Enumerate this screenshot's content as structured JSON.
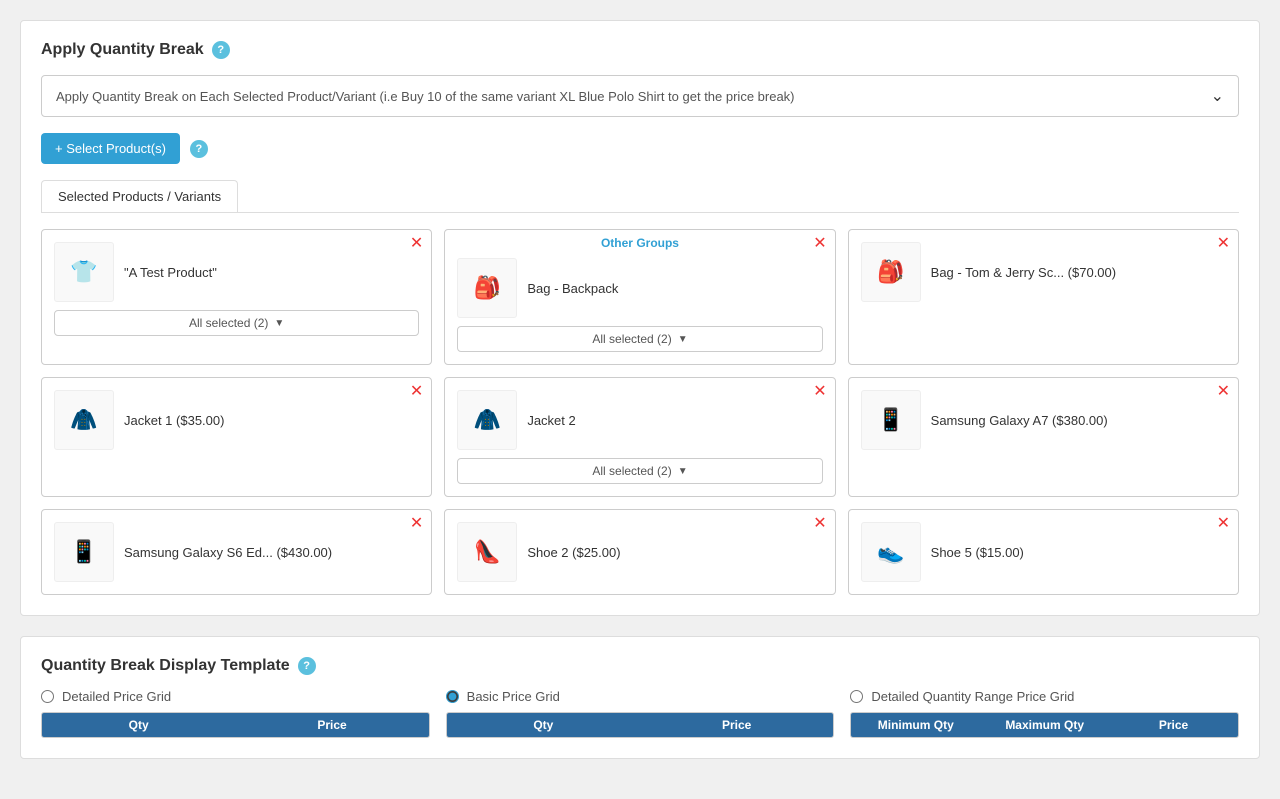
{
  "apply_qty_break": {
    "title": "Apply Quantity Break",
    "dropdown_value": "Apply Quantity Break on Each Selected Product/Variant (i.e Buy 10 of the same variant XL Blue Polo Shirt to get the price break)",
    "select_btn_label": "+ Select Product(s)",
    "tab_label": "Selected Products / Variants"
  },
  "products": [
    {
      "id": "a-test-product",
      "name": "\"A Test Product\"",
      "emoji": "👕",
      "has_variant_dropdown": true,
      "variant_label": "All selected (2)",
      "other_groups": false
    },
    {
      "id": "bag-backpack",
      "name": "Bag - Backpack",
      "emoji": "🎒",
      "has_variant_dropdown": true,
      "variant_label": "All selected (2)",
      "other_groups": true,
      "other_groups_label": "Other Groups"
    },
    {
      "id": "bag-tom-jerry",
      "name": "Bag - Tom & Jerry Sc... ($70.00)",
      "emoji": "🎒",
      "has_variant_dropdown": false,
      "other_groups": false
    },
    {
      "id": "jacket-1",
      "name": "Jacket 1 ($35.00)",
      "emoji": "🧥",
      "has_variant_dropdown": false,
      "other_groups": false
    },
    {
      "id": "jacket-2",
      "name": "Jacket 2",
      "emoji": "🧥",
      "has_variant_dropdown": true,
      "variant_label": "All selected (2)",
      "other_groups": false
    },
    {
      "id": "samsung-galaxy-a7",
      "name": "Samsung Galaxy A7 ($380.00)",
      "emoji": "📱",
      "has_variant_dropdown": false,
      "other_groups": false
    },
    {
      "id": "samsung-galaxy-s6",
      "name": "Samsung Galaxy S6 Ed... ($430.00)",
      "emoji": "📱",
      "has_variant_dropdown": false,
      "other_groups": false
    },
    {
      "id": "shoe-2",
      "name": "Shoe 2 ($25.00)",
      "emoji": "👠",
      "has_variant_dropdown": false,
      "other_groups": false
    },
    {
      "id": "shoe-5",
      "name": "Shoe 5 ($15.00)",
      "emoji": "👟",
      "has_variant_dropdown": false,
      "other_groups": false
    }
  ],
  "display_template": {
    "title": "Quantity Break Display Template",
    "options": [
      {
        "id": "detailed",
        "label": "Detailed Price Grid",
        "checked": false
      },
      {
        "id": "basic",
        "label": "Basic Price Grid",
        "checked": true
      },
      {
        "id": "detailed-range",
        "label": "Detailed Quantity Range Price Grid",
        "checked": false
      }
    ],
    "tables": [
      {
        "cols": [
          "Qty",
          "Price"
        ]
      },
      {
        "cols": [
          "Qty",
          "Price"
        ]
      },
      {
        "cols": [
          "Minimum Qty",
          "Maximum Qty",
          "Price"
        ]
      }
    ]
  }
}
